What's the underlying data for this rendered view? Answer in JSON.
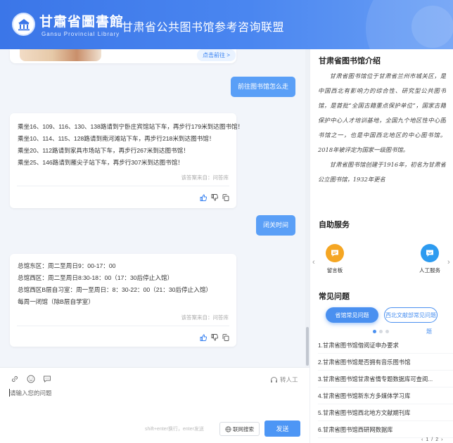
{
  "header": {
    "logo_cn": "甘肅省圖書館",
    "logo_en": "Gansu Provincial Library",
    "title": "甘肃省公共图书馆参考咨询联盟"
  },
  "chat": {
    "goto_link": "点击前往 >",
    "messages": [
      {
        "role": "user",
        "text": "前往图书馆怎么走"
      },
      {
        "role": "bot",
        "lines": [
          "乘坐16、109、116、130、138路请到宁卧庄宾馆站下车，再步行179米到达图书馆！",
          "乘坐10、114、115、128路请到南河滩站下车，再步行218米到达图书馆！",
          "乘坐20、112路请到家具市场站下车，再步行267米到达图书馆！",
          "乘坐25、146路请到雁尖子站下车，再步行307米到达图书馆！"
        ],
        "source": "该答案来自：问答库"
      },
      {
        "role": "user",
        "text": "闭关时间"
      },
      {
        "role": "bot",
        "lines": [
          "总馆东区：周二至周日9：00-17：00",
          "总馆西区：周二至周日8:30-18：00（17：30后停止入馆）",
          "总馆西区B层自习室：周一至周日：8：30-22：00（21：30后停止入馆）",
          "每周一闭馆（除B层自学室）"
        ],
        "source": "该答案来自：问答库"
      }
    ]
  },
  "input": {
    "human_service": "转人工",
    "placeholder": "请输入您的问题",
    "hint": "shift+enter换行，enter发送",
    "web_search": "联网搜索",
    "send": "发送"
  },
  "right": {
    "intro_title": "甘肃省图书馆介绍",
    "intro_paragraphs": [
      "甘肃省图书馆位于甘肃省兰州市城关区，是中国西北有影响力的综合性、研究型公共图书馆，是首批“全国古籍重点保护单位”，国家古籍保护中心人才培训基地，全国九个地区性中心图书馆之一，也是中国西北地区的中心图书馆。2018年被评定为国家一级图书馆。",
      "甘肃省图书馆创建于1916年，初名为甘肃省公立图书馆，1932年更名"
    ],
    "self_service_title": "自助服务",
    "self_service": [
      {
        "label": "留言板",
        "icon": "message-board-icon",
        "color": "#f5a623"
      },
      {
        "label": "人工服务",
        "icon": "human-service-icon",
        "color": "#2d9bf0"
      }
    ],
    "faq_title": "常见问题",
    "faq_tabs": [
      "省馆常见问题",
      "西北文献部常见问题"
    ],
    "faq_tab_wrap": "题",
    "faq_items": [
      "1.甘肃省图书馆借阅证申办要求",
      "2.甘肃省图书馆是否拥有音乐图书馆",
      "3.甘肃省图书馆甘肃省情专题数据库可查阅...",
      "4.甘肃省图书馆新东方多媒体学习库",
      "5.甘肃省图书馆西北地方文献期刊库",
      "6.甘肃省图书馆西研网数据库"
    ],
    "faq_pager": [
      "‹",
      "1",
      "/",
      "2",
      "›"
    ]
  },
  "colors": {
    "header_blue": "#3b76e8",
    "user_bubble": "#5a9ff7",
    "send_button": "#4d96f5",
    "link_blue": "#2f7cf0"
  }
}
